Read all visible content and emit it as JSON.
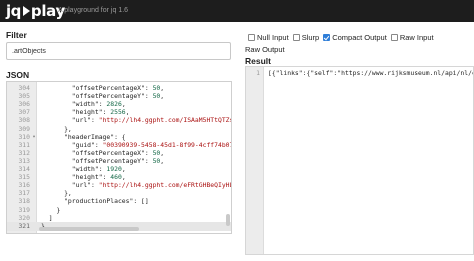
{
  "app": {
    "brand_jq": "jq",
    "brand_play": "play",
    "tagline": "A playground for jq 1.6"
  },
  "filter": {
    "label": "Filter",
    "value": ".artObjects"
  },
  "json": {
    "label": "JSON",
    "lines": [
      {
        "num": "304",
        "fold": "",
        "parts": [
          [
            "k",
            "        \"offsetPercentageX\": "
          ],
          [
            "n",
            "50"
          ],
          [
            "k",
            ","
          ]
        ]
      },
      {
        "num": "305",
        "fold": "",
        "parts": [
          [
            "k",
            "        \"offsetPercentageY\": "
          ],
          [
            "n",
            "50"
          ],
          [
            "k",
            ","
          ]
        ]
      },
      {
        "num": "306",
        "fold": "",
        "parts": [
          [
            "k",
            "        \"width\": "
          ],
          [
            "n",
            "2826"
          ],
          [
            "k",
            ","
          ]
        ]
      },
      {
        "num": "307",
        "fold": "",
        "parts": [
          [
            "k",
            "        \"height\": "
          ],
          [
            "n",
            "2556"
          ],
          [
            "k",
            ","
          ]
        ]
      },
      {
        "num": "308",
        "fold": "",
        "parts": [
          [
            "k",
            "        \"url\": "
          ],
          [
            "s",
            "\"http://lh4.ggpht.com/ISAaM5HTtQTZs7"
          ]
        ]
      },
      {
        "num": "309",
        "fold": "",
        "parts": [
          [
            "k",
            "      },"
          ]
        ]
      },
      {
        "num": "310",
        "fold": "▾",
        "parts": [
          [
            "k",
            "      \"headerImage\": {"
          ]
        ]
      },
      {
        "num": "311",
        "fold": "",
        "parts": [
          [
            "k",
            "        \"guid\": "
          ],
          [
            "s",
            "\"00390939-5458-45d1-8f99-4cff74b07c"
          ]
        ]
      },
      {
        "num": "312",
        "fold": "",
        "parts": [
          [
            "k",
            "        \"offsetPercentageX\": "
          ],
          [
            "n",
            "50"
          ],
          [
            "k",
            ","
          ]
        ]
      },
      {
        "num": "313",
        "fold": "",
        "parts": [
          [
            "k",
            "        \"offsetPercentageY\": "
          ],
          [
            "n",
            "50"
          ],
          [
            "k",
            ","
          ]
        ]
      },
      {
        "num": "314",
        "fold": "",
        "parts": [
          [
            "k",
            "        \"width\": "
          ],
          [
            "n",
            "1920"
          ],
          [
            "k",
            ","
          ]
        ]
      },
      {
        "num": "315",
        "fold": "",
        "parts": [
          [
            "k",
            "        \"height\": "
          ],
          [
            "n",
            "460"
          ],
          [
            "k",
            ","
          ]
        ]
      },
      {
        "num": "316",
        "fold": "",
        "parts": [
          [
            "k",
            "        \"url\": "
          ],
          [
            "s",
            "\"http://lh4.ggpht.com/eFRtGHBeQIyHLV"
          ]
        ]
      },
      {
        "num": "317",
        "fold": "",
        "parts": [
          [
            "k",
            "      },"
          ]
        ]
      },
      {
        "num": "318",
        "fold": "",
        "parts": [
          [
            "k",
            "      \"productionPlaces\": []"
          ]
        ]
      },
      {
        "num": "319",
        "fold": "",
        "parts": [
          [
            "k",
            "    }"
          ]
        ]
      },
      {
        "num": "320",
        "fold": "",
        "parts": [
          [
            "k",
            "  ]"
          ]
        ]
      },
      {
        "num": "321",
        "fold": "",
        "parts": [
          [
            "k",
            "}"
          ]
        ],
        "active": true
      }
    ]
  },
  "options": {
    "null_input": {
      "label": "Null Input",
      "checked": false
    },
    "slurp": {
      "label": "Slurp",
      "checked": false
    },
    "compact_output": {
      "label": "Compact Output",
      "checked": true
    },
    "raw_input": {
      "label": "Raw Input",
      "checked": false
    },
    "raw_output": {
      "label": "Raw Output",
      "checked": false
    }
  },
  "result": {
    "label": "Result",
    "line_number": "1",
    "text": "[{\"links\":{\"self\":\"https://www.rijksmuseum.nl/api/nl/co"
  },
  "colors": {
    "navbar": "#1d1d1d",
    "checkbox_on": "#2f7ed8",
    "string": "#aa1111",
    "number": "#116644"
  }
}
